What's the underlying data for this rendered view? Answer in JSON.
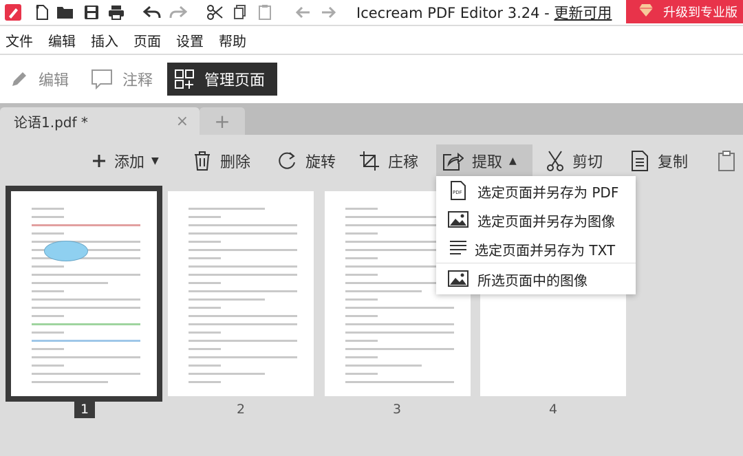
{
  "titlebar": {
    "app_title": "Icecream PDF Editor 3.24",
    "separator": " - ",
    "update_label": "更新可用",
    "upgrade_label": "升级到专业版"
  },
  "menu": [
    "文件",
    "编辑",
    "插入",
    "页面",
    "设置",
    "帮助"
  ],
  "modes": {
    "edit": "编辑",
    "annotate": "注释",
    "manage": "管理页面"
  },
  "tabs": {
    "document": "论语1.pdf *",
    "close": "×",
    "add": "+"
  },
  "page_tools": {
    "add": "添加",
    "delete": "删除",
    "rotate": "旋转",
    "crop": "庄稼",
    "extract": "提取",
    "cut": "剪切",
    "copy": "复制"
  },
  "extract_menu": [
    {
      "icon": "pdf-file-icon",
      "label": "选定页面并另存为 PDF"
    },
    {
      "icon": "image-icon",
      "label": "选定页面并另存为图像"
    },
    {
      "icon": "text-lines-icon",
      "label": "选定页面并另存为 TXT"
    },
    {
      "icon": "image-icon",
      "label": "所选页面中的图像"
    }
  ],
  "pages": [
    {
      "number": "1",
      "selected": true
    },
    {
      "number": "2",
      "selected": false
    },
    {
      "number": "3",
      "selected": false
    },
    {
      "number": "4",
      "selected": false
    }
  ],
  "colors": {
    "upgrade_bg": "#e8334a",
    "active_mode_bg": "#2f2f2f",
    "app_icon": "#e8334a"
  }
}
